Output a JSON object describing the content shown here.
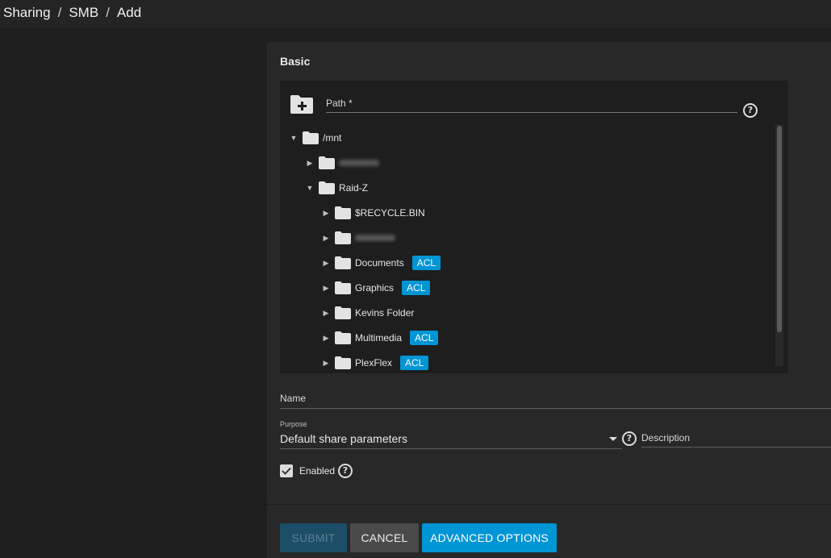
{
  "breadcrumb": {
    "items": [
      "Sharing",
      "SMB",
      "Add"
    ]
  },
  "form": {
    "section_title": "Basic",
    "path": {
      "label": "Path *"
    },
    "tree": [
      {
        "label": "/mnt",
        "expanded": true,
        "blurred": false
      },
      {
        "label": "",
        "expanded": false,
        "blurred": true
      },
      {
        "label": "Raid-Z",
        "expanded": true,
        "blurred": false
      },
      {
        "label": "$RECYCLE.BIN",
        "expanded": false,
        "blurred": false
      },
      {
        "label": "",
        "expanded": false,
        "blurred": true
      },
      {
        "label": "Documents",
        "expanded": false,
        "blurred": false,
        "badge": "ACL"
      },
      {
        "label": "Graphics",
        "expanded": false,
        "blurred": false,
        "badge": "ACL"
      },
      {
        "label": "Kevins Folder",
        "expanded": false,
        "blurred": false
      },
      {
        "label": "Multimedia",
        "expanded": false,
        "blurred": false,
        "badge": "ACL"
      },
      {
        "label": "PlexFlex",
        "expanded": false,
        "blurred": false,
        "badge": "ACL"
      }
    ],
    "name": {
      "label": "Name",
      "value": ""
    },
    "purpose": {
      "small_label": "Purpose",
      "value": "Default share parameters"
    },
    "description": {
      "label": "Description",
      "value": ""
    },
    "enabled": {
      "label": "Enabled",
      "checked": true
    }
  },
  "buttons": {
    "submit": "SUBMIT",
    "cancel": "CANCEL",
    "advanced": "ADVANCED OPTIONS"
  },
  "colors": {
    "accent": "#0095d5",
    "acl_badge": "#0095d5",
    "card": "#282828",
    "background": "#1e1e1e"
  }
}
